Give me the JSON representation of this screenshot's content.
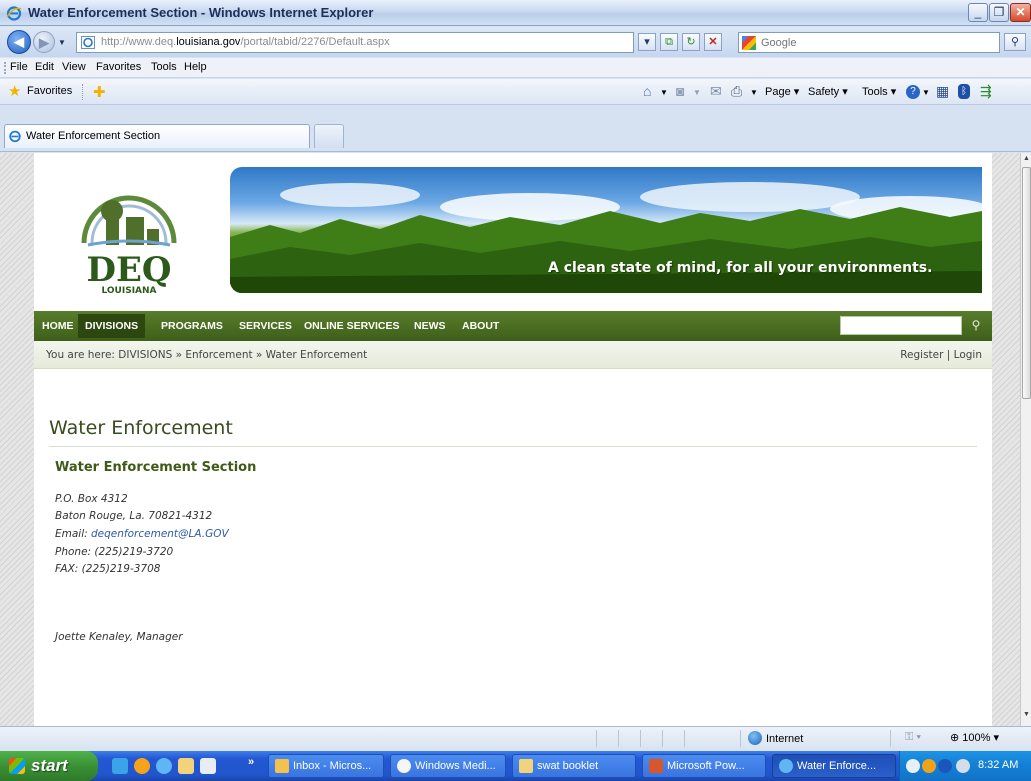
{
  "window": {
    "title": "Water Enforcement Section - Windows Internet Explorer"
  },
  "address": {
    "url_prefix": "http://www.deq.",
    "url_host": "louisiana.gov",
    "url_suffix": "/portal/tabid/2276/Default.aspx"
  },
  "search": {
    "placeholder": "Google"
  },
  "menu": [
    "File",
    "Edit",
    "View",
    "Favorites",
    "Tools",
    "Help"
  ],
  "favorites": {
    "label": "Favorites"
  },
  "commandbar": {
    "page": "Page",
    "safety": "Safety",
    "tools": "Tools"
  },
  "tab": {
    "label": "Water Enforcement Section"
  },
  "site": {
    "logo_text": "DEQ",
    "logo_subtext": "LOUISIANA",
    "tagline": "A clean state of mind, for all your environments.",
    "nav": [
      "HOME",
      "DIVISIONS",
      "PROGRAMS",
      "SERVICES",
      "ONLINE SERVICES",
      "NEWS",
      "ABOUT"
    ],
    "active_nav": "DIVISIONS",
    "breadcrumb": "You are here: DIVISIONS » Enforcement » Water Enforcement",
    "register": "Register",
    "login": "Login",
    "page_title": "Water Enforcement",
    "section_title": "Water Enforcement Section",
    "address_lines": {
      "po_box": "P.O. Box 4312",
      "city": "Baton Rouge, La. 70821-4312",
      "email_label": "Email: ",
      "email": "deqenforcement@LA.GOV",
      "phone": "Phone: (225)219-3720",
      "fax": "FAX: (225)219-3708"
    },
    "manager": "Joette Kenaley, Manager"
  },
  "statusbar": {
    "zone": "Internet",
    "zoom": "100%"
  },
  "taskbar": {
    "start": "start",
    "buttons": [
      {
        "label": "Inbox - Micros..."
      },
      {
        "label": "Windows Medi..."
      },
      {
        "label": "swat booklet"
      },
      {
        "label": "Microsoft Pow..."
      },
      {
        "label": "Water Enforce..."
      }
    ],
    "clock": "8:32 AM"
  },
  "colors": {
    "nav_green": "#4a6b22",
    "title_green": "#3f5a16",
    "xp_blue": "#2458d3",
    "start_green": "#3a9135"
  }
}
